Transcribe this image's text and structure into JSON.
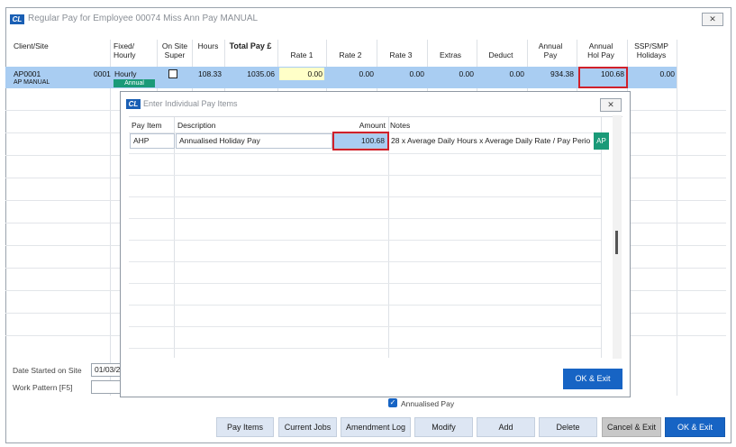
{
  "window": {
    "title": "Regular Pay for Employee 00074 Miss Ann Pay MANUAL",
    "logo": "CL",
    "close": "✕"
  },
  "columns": {
    "client_site": "Client/Site",
    "fixed_hourly": [
      "Fixed/",
      "Hourly"
    ],
    "on_site_super": [
      "On Site",
      "Super"
    ],
    "hours": "Hours",
    "total_pay": "Total Pay £",
    "rate1": "Rate 1",
    "rate2": "Rate 2",
    "rate3": "Rate 3",
    "extras": "Extras",
    "deduct": "Deduct",
    "annual_pay": [
      "Annual",
      "Pay"
    ],
    "annual_hol_pay": [
      "Annual",
      "Hol Pay"
    ],
    "ssp_smp": [
      "SSP/SMP",
      "Holidays"
    ]
  },
  "row": {
    "site_code": "AP0001",
    "site_num": "0001",
    "site_name": "AP MANUAL",
    "fixed_hourly": "Hourly",
    "badge": "Annual",
    "on_site_super": false,
    "hours": "108.33",
    "total_pay": "1035.06",
    "rate1": "0.00",
    "rate2": "0.00",
    "rate3": "0.00",
    "extras": "0.00",
    "deduct": "0.00",
    "annual_pay": "934.38",
    "annual_hol_pay": "100.68",
    "ssp_smp": "0.00"
  },
  "dialog": {
    "title": "Enter Individual Pay Items",
    "logo": "CL",
    "close": "✕",
    "headers": {
      "pay_item": "Pay Item",
      "description": "Description",
      "amount": "Amount",
      "notes": "Notes"
    },
    "item": {
      "pay_item": "AHP",
      "description": "Annualised Holiday Pay",
      "amount": "100.68",
      "notes": "28 x Average Daily Hours x Average Daily Rate / Pay Perio",
      "ap_button": "AP"
    },
    "ok_exit": "OK & Exit"
  },
  "footer": {
    "date_started_label": "Date Started on Site",
    "date_started_value": "01/03/2",
    "work_pattern_label": "Work Pattern [F5]",
    "work_pattern_value": "",
    "annualised_pay_label": "Annualised Pay",
    "annualised_pay_checked": true
  },
  "buttons": {
    "pay_items": "Pay Items",
    "current_jobs": "Current Jobs",
    "amendment_log": "Amendment Log",
    "modify": "Modify",
    "add": "Add",
    "delete": "Delete",
    "cancel_exit": "Cancel & Exit",
    "ok_exit": "OK & Exit"
  },
  "colors": {
    "accent": "#1764c4",
    "selection": "#a9cdf2",
    "highlight_border": "#d0202a",
    "badge": "#1a9a78"
  }
}
